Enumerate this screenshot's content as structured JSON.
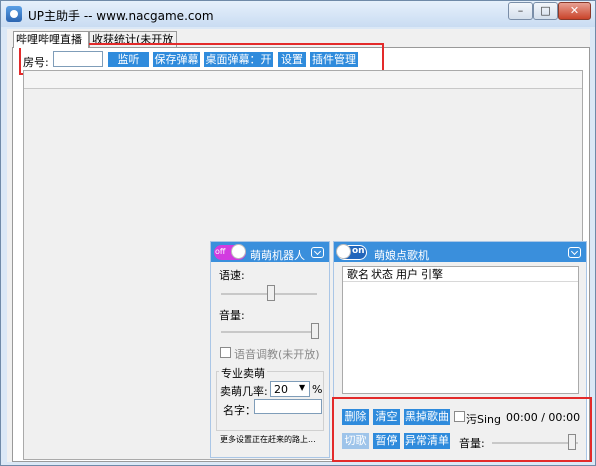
{
  "window": {
    "title": "UP主助手 -- www.nacgame.com",
    "min_label": "–",
    "max_label": "□",
    "close_label": "✕"
  },
  "tabs": [
    {
      "label": "哔哩哔哩直播"
    },
    {
      "label": "收获统计(未开放"
    }
  ],
  "toolbar": {
    "room_label": "房号:",
    "room_value": "",
    "listen": "监听",
    "save_danmaku": "保存弹幕",
    "desktop_danmaku": "桌面弹幕：开",
    "settings": "设置",
    "plugins": "插件管理"
  },
  "robot": {
    "toggle": "off",
    "title": "萌萌机器人",
    "speed_label": "语速:",
    "speed_value": 0.5,
    "volume_label": "音量:",
    "volume_value": 1.0,
    "voice_train": "语音调教(未开放)",
    "pro_label": "专业卖萌",
    "rate_label": "卖萌几率:",
    "rate_value": "20",
    "rate_unit": "%",
    "name_label": "名字：",
    "name_value": "",
    "more_text": "更多设置正在赶来的路上..."
  },
  "songs": {
    "toggle": "on",
    "title": "萌娘点歌机",
    "columns": [
      "歌名",
      "状态",
      "用户",
      "引擎"
    ],
    "rows": [],
    "buttons_row1": [
      "删除",
      "清空",
      "黑掉歌曲"
    ],
    "sing_label": "污Sing",
    "time": "00:00 / 00:00",
    "buttons_row2": [
      "切歌",
      "暂停",
      "异常清单"
    ],
    "volume_label": "音量:",
    "volume_value": 1.0
  },
  "colors": {
    "accent": "#2f8bdc",
    "highlight": "#e32a2a",
    "off_toggle": "#d23be0"
  }
}
